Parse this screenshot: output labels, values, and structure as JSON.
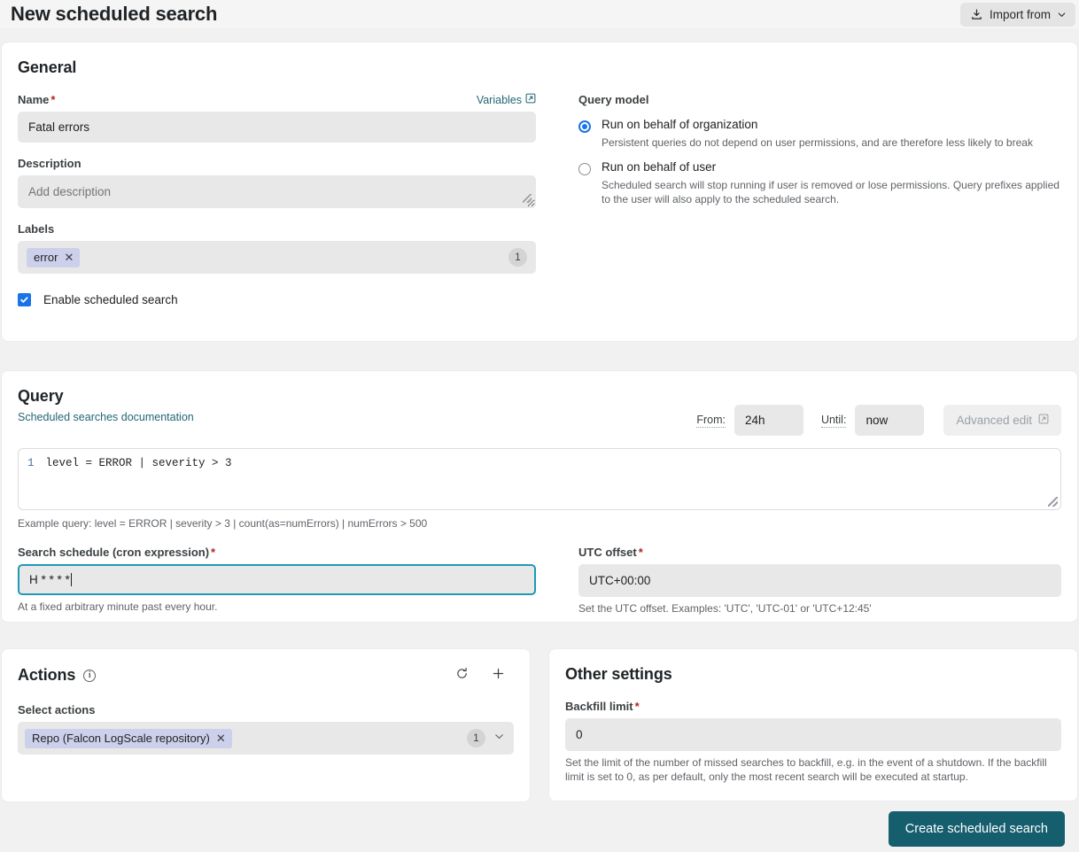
{
  "header": {
    "title": "New scheduled search",
    "import_button": "Import from",
    "import_icon": "import-download-icon",
    "chevron_icon": "chevron-down-icon"
  },
  "general": {
    "title": "General",
    "name": {
      "label": "Name",
      "required": "*",
      "value": "Fatal errors",
      "variables_link": "Variables",
      "variables_icon": "external-link-icon"
    },
    "description": {
      "label": "Description",
      "placeholder": "Add description",
      "value": ""
    },
    "labels": {
      "label": "Labels",
      "chips": [
        "error"
      ],
      "chip_remove_icon": "close-icon",
      "count": "1"
    },
    "enable": {
      "label": "Enable scheduled search",
      "checked": true
    },
    "query_model": {
      "title": "Query model",
      "options": [
        {
          "label": "Run on behalf of organization",
          "description": "Persistent queries do not depend on user permissions, and are therefore less likely to break",
          "selected": true
        },
        {
          "label": "Run on behalf of user",
          "description": "Scheduled search will stop running if user is removed or lose permissions. Query prefixes applied to the user will also apply to the scheduled search.",
          "selected": false
        }
      ]
    }
  },
  "query": {
    "title": "Query",
    "doc_link": "Scheduled searches documentation",
    "from_label": "From:",
    "from_value": "24h",
    "until_label": "Until:",
    "until_value": "now",
    "advanced_edit": "Advanced edit",
    "advanced_edit_icon": "external-link-icon",
    "editor": {
      "line_number": "1",
      "text": "level = ERROR | severity > 3"
    },
    "example": "Example query: level = ERROR | severity > 3 | count(as=numErrors) | numErrors > 500",
    "cron": {
      "label": "Search schedule (cron expression)",
      "required": "*",
      "value": "H * * * *",
      "helper": "At a fixed arbitrary minute past every hour.",
      "focused": true
    },
    "utc": {
      "label": "UTC offset",
      "required": "*",
      "value": "UTC+00:00",
      "helper": "Set the UTC offset. Examples: 'UTC', 'UTC-01' or 'UTC+12:45'"
    }
  },
  "actions": {
    "title": "Actions",
    "info_icon": "info-icon",
    "refresh_icon": "refresh-icon",
    "add_icon": "plus-icon",
    "select_label": "Select actions",
    "chips": [
      "Repo (Falcon LogScale repository)"
    ],
    "chip_remove_icon": "close-icon",
    "count": "1",
    "chevron_icon": "chevron-down-icon"
  },
  "other_settings": {
    "title": "Other settings",
    "backfill": {
      "label": "Backfill limit",
      "required": "*",
      "value": "0",
      "helper": "Set the limit of the number of missed searches to backfill, e.g. in the event of a shutdown. If the backfill limit is set to 0, as per default, only the most recent search will be executed at startup."
    }
  },
  "footer": {
    "submit": "Create scheduled search"
  },
  "colors": {
    "accent_teal": "#155e6e",
    "link_teal": "#226677",
    "focus_teal": "#1f9ab5",
    "radio_blue": "#1a73e8",
    "chip_lavender": "#ccd0ea",
    "required_red": "#b3261e",
    "page_bg": "#f1f1f1",
    "input_bg": "#e8e8e8"
  }
}
